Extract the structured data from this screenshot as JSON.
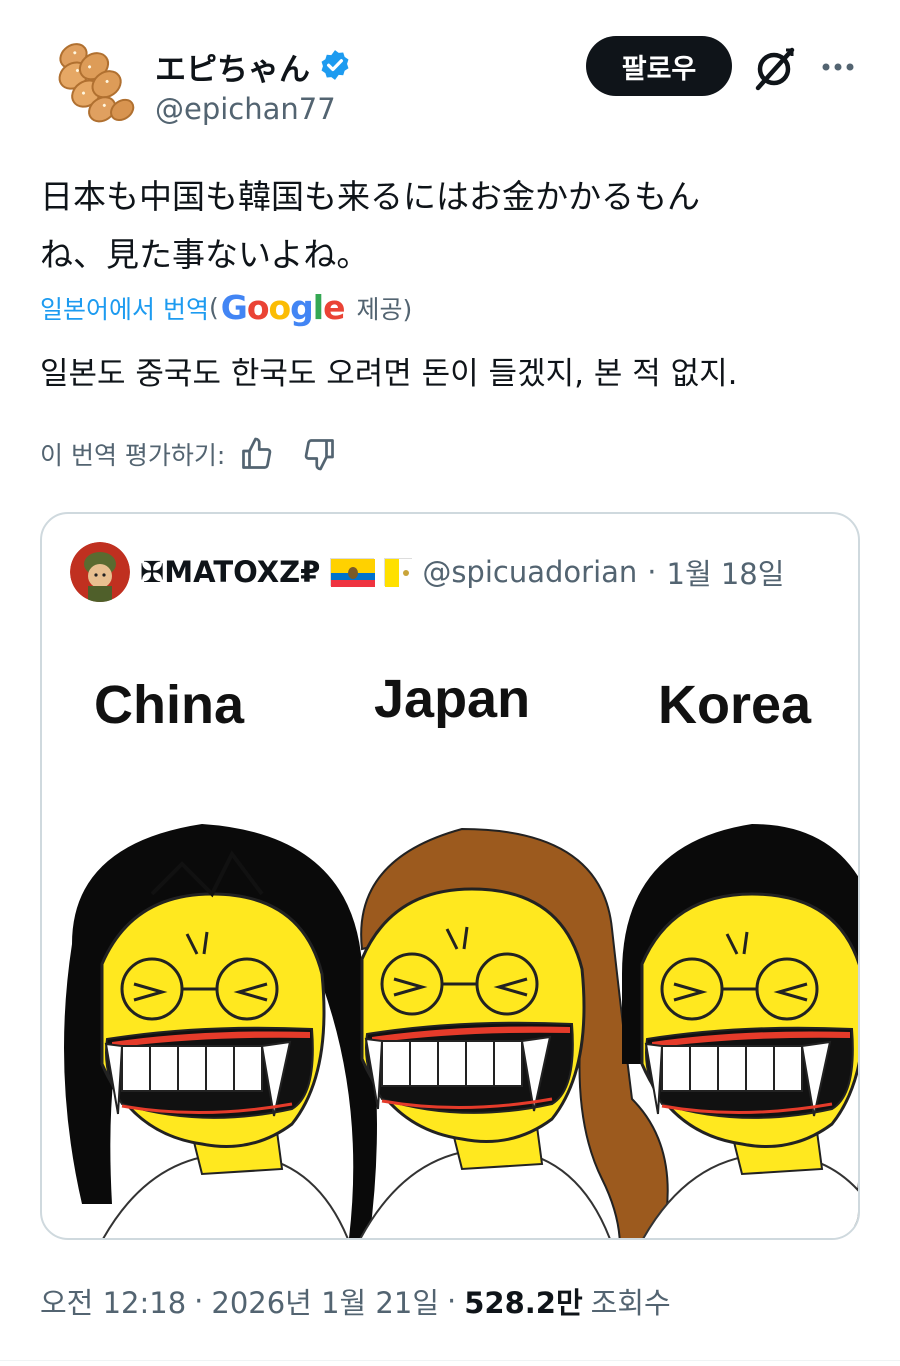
{
  "author": {
    "display_name": "エピちゃん",
    "handle": "@epichan77",
    "verified_icon": "verified-badge-icon"
  },
  "actions": {
    "follow_label": "팔로우",
    "grok_icon": "grok-icon",
    "more_icon": "more-icon"
  },
  "tweet": {
    "text_line1": "日本も中国も韓国も来るにはお金かかるもん",
    "text_line2": "ね、見た事ないよね。",
    "translate_link": "일본어에서 번역",
    "translate_open": "(",
    "google_logo": "Google",
    "translate_provided": "제공)",
    "translation": "일본도 중국도 한국도 오려면 돈이 들겠지, 본 적 없지.",
    "rate_label": "이 번역 평가하기:"
  },
  "quote": {
    "name": "✠MATOXZ₽",
    "handle": "@spicuadorian",
    "separator": "·",
    "date": "1월 18일",
    "labels": [
      "China",
      "Japan",
      "Korea"
    ]
  },
  "footer": {
    "time": "오전 12:18",
    "sep1": "·",
    "date": "2026년 1월 21일",
    "sep2": "·",
    "views_num": "528.2만",
    "views_label": "조회수"
  },
  "colors": {
    "follow_bg": "#0f1419",
    "link": "#1d9bf0",
    "verified": "#1d9bf0",
    "secondary_text": "#536471",
    "face_yellow": "#ffe81f"
  }
}
